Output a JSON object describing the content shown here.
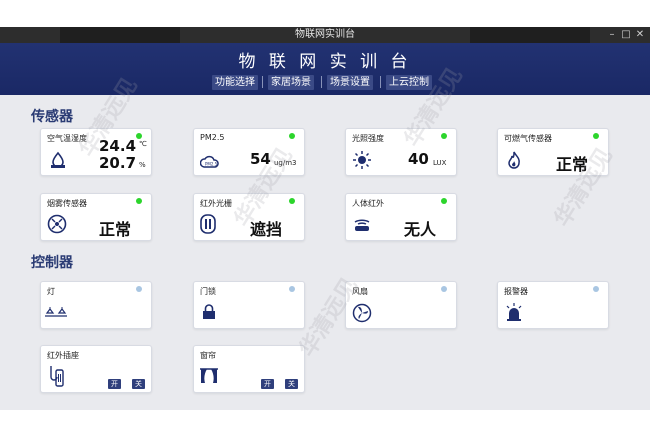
{
  "window": {
    "title": "物联网实训台"
  },
  "header": {
    "title": "物 联 网 实 训 台",
    "nav": [
      "功能选择",
      "家居场景",
      "场景设置",
      "上云控制"
    ]
  },
  "sections": {
    "sensors": "传感器",
    "controllers": "控制器"
  },
  "sensors": {
    "temp_humidity": {
      "label": "空气温湿度",
      "temp": "24.4",
      "temp_unit": "℃",
      "humidity": "20.7",
      "humidity_unit": "%"
    },
    "pm25": {
      "label": "PM2.5",
      "value": "54",
      "unit": "ug/m3",
      "icon_text": "PM2.5"
    },
    "light": {
      "label": "光照强度",
      "value": "40",
      "unit": "LUX"
    },
    "gas": {
      "label": "可燃气传感器",
      "value": "正常"
    },
    "smoke": {
      "label": "烟雾传感器",
      "value": "正常"
    },
    "infrared_grating": {
      "label": "红外光栅",
      "value": "遮挡"
    },
    "human_infrared": {
      "label": "人体红外",
      "value": "无人"
    }
  },
  "controllers": {
    "lamp": {
      "label": "灯"
    },
    "door_lock": {
      "label": "门锁"
    },
    "fan": {
      "label": "风扇"
    },
    "alarm": {
      "label": "报警器"
    },
    "ir_socket": {
      "label": "红外插座",
      "on": "开",
      "off": "关"
    },
    "curtain": {
      "label": "窗帘",
      "on": "开",
      "off": "关"
    }
  },
  "watermark": "华清远见",
  "colors": {
    "header_bg": "#1f2e6e",
    "nav_bg": "#3b4a86",
    "panel_bg": "#e9eaee",
    "led_on": "#2cd52c",
    "led_off": "#a9c6e2",
    "section_title": "#2a3b74"
  }
}
